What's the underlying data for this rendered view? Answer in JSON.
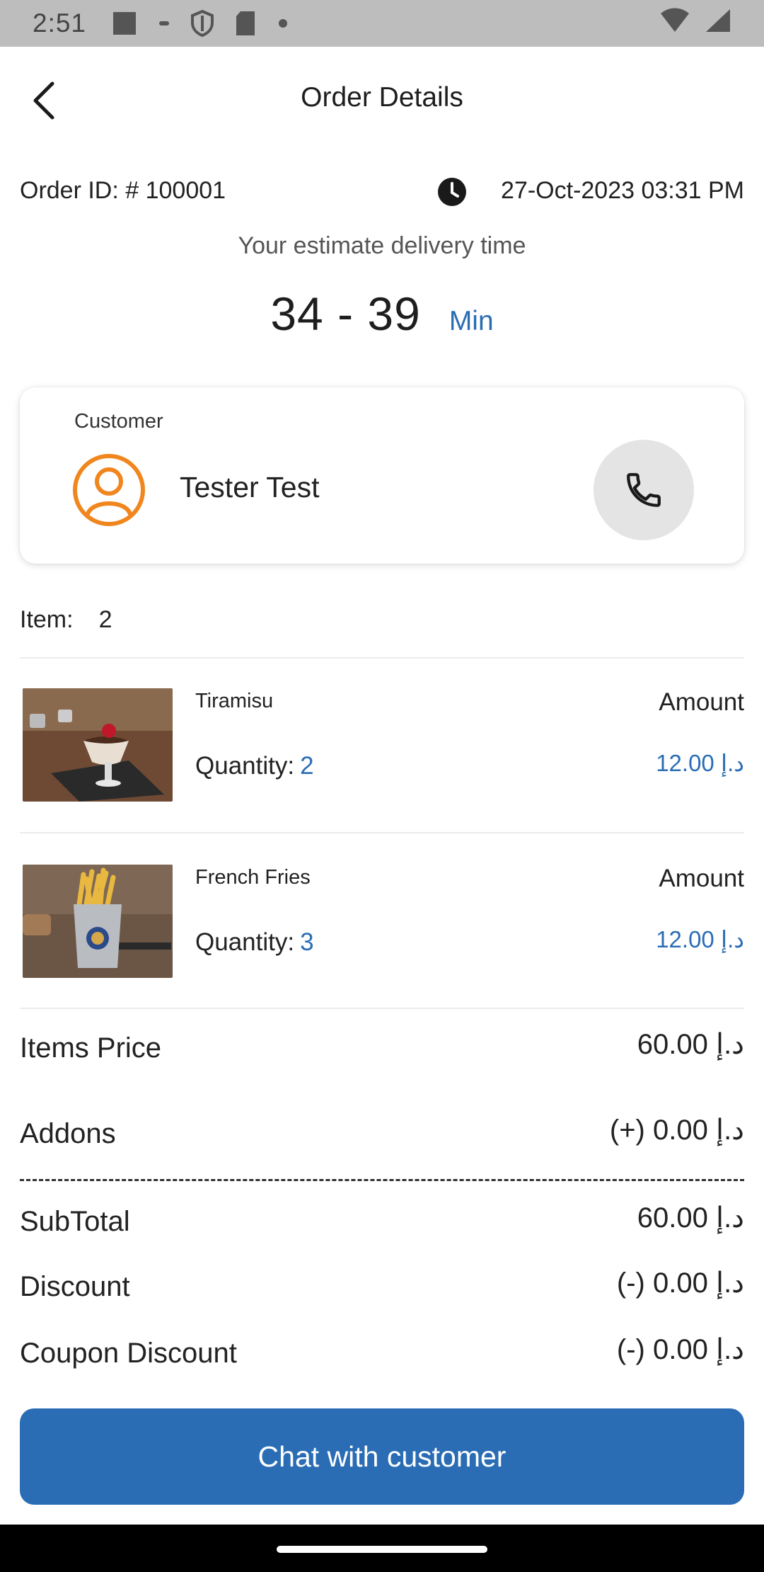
{
  "status_bar": {
    "time": "2:51",
    "icons": [
      "square-icon",
      "minus-icon",
      "shield-icon",
      "sd-card-icon",
      "dot-icon"
    ],
    "right_icons": [
      "wifi-icon",
      "signal-icon"
    ]
  },
  "header": {
    "title": "Order Details",
    "back_icon": "chevron-left-icon"
  },
  "order": {
    "id_text": "Order ID: # 100001",
    "date": "27-Oct-2023 03:31 PM",
    "estimate_label": "Your estimate delivery time",
    "estimate_time": "34 - 39",
    "estimate_unit": "Min"
  },
  "customer": {
    "label": "Customer",
    "name": "Tester Test",
    "avatar_icon": "user-circle-icon",
    "call_icon": "phone-icon"
  },
  "items": {
    "label": "Item:",
    "count": "2",
    "list": [
      {
        "name": "Tiramisu",
        "qty_label": "Quantity:",
        "qty": "2",
        "amount_label": "Amount",
        "amount": "12.00 د.إ"
      },
      {
        "name": "French Fries",
        "qty_label": "Quantity:",
        "qty": "3",
        "amount_label": "Amount",
        "amount": "12.00 د.إ"
      }
    ]
  },
  "summary": {
    "items_price_label": "Items Price",
    "items_price": "60.00 د.إ",
    "addons_label": "Addons",
    "addons": "(+) 0.00 د.إ",
    "subtotal_label": "SubTotal",
    "subtotal": "60.00 د.إ",
    "discount_label": "Discount",
    "discount": "(-) 0.00 د.إ",
    "coupon_label": "Coupon Discount",
    "coupon": "(-) 0.00 د.إ"
  },
  "actions": {
    "chat_label": "Chat with customer"
  },
  "colors": {
    "accent": "#2a6db5",
    "avatar": "#f0861d",
    "call_bg": "#e4e4e4",
    "status_bar": "#bdbdbd"
  }
}
